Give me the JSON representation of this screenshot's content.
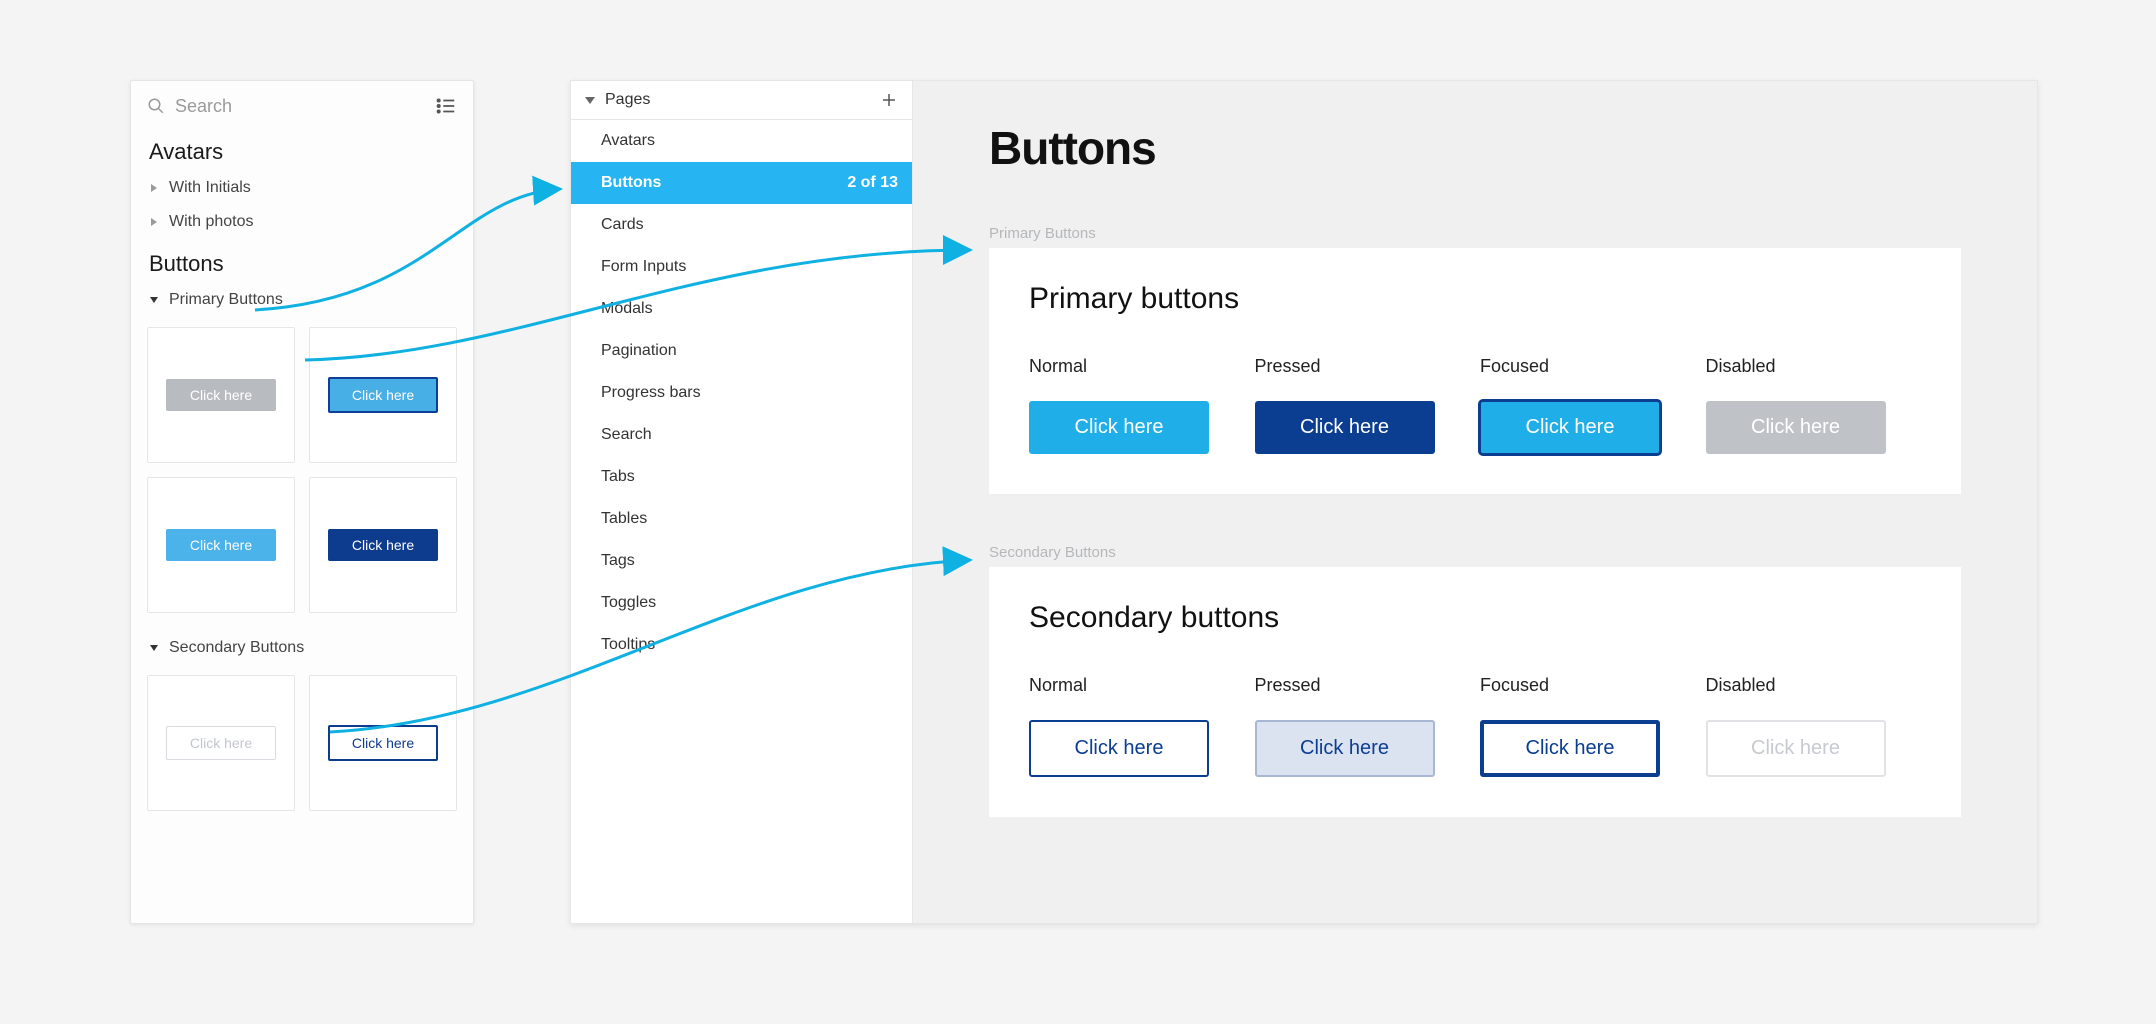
{
  "componentsPanel": {
    "searchPlaceholder": "Search",
    "sections": {
      "avatars": {
        "title": "Avatars",
        "items": [
          "With Initials",
          "With photos"
        ]
      },
      "buttons": {
        "title": "Buttons",
        "groups": {
          "primary": {
            "label": "Primary Buttons",
            "thumbLabel": "Click here"
          },
          "secondary": {
            "label": "Secondary Buttons",
            "thumbLabel": "Click here"
          }
        }
      }
    }
  },
  "pagesPane": {
    "header": "Pages",
    "items": [
      "Avatars",
      "Buttons",
      "Cards",
      "Form Inputs",
      "Modals",
      "Pagination",
      "Progress bars",
      "Search",
      "Tabs",
      "Tables",
      "Tags",
      "Toggles",
      "Tooltips"
    ],
    "selectedIndex": 1,
    "selectedCount": "2 of 13"
  },
  "canvas": {
    "title": "Buttons",
    "frames": {
      "primary": {
        "label": "Primary Buttons",
        "heading": "Primary buttons",
        "states": [
          "Normal",
          "Pressed",
          "Focused",
          "Disabled"
        ],
        "buttonText": "Click here"
      },
      "secondary": {
        "label": "Secondary Buttons",
        "heading": "Secondary buttons",
        "states": [
          "Normal",
          "Pressed",
          "Focused",
          "Disabled"
        ],
        "buttonText": "Click here"
      }
    }
  }
}
